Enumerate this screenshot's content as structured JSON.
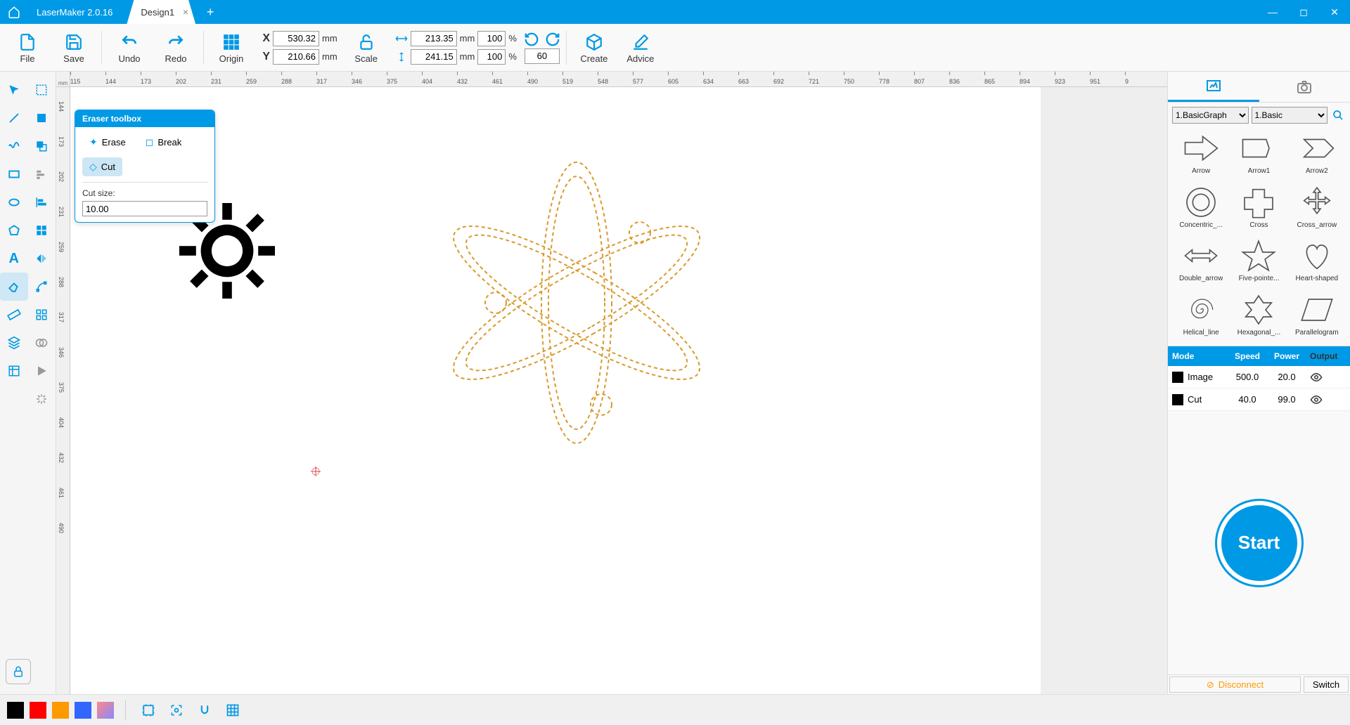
{
  "app": {
    "title": "LaserMaker 2.0.16",
    "tab_name": "Design1"
  },
  "toolbar": {
    "file": "File",
    "save": "Save",
    "undo": "Undo",
    "redo": "Redo",
    "origin": "Origin",
    "scale": "Scale",
    "create": "Create",
    "advice": "Advice",
    "x_label": "X",
    "y_label": "Y",
    "x_value": "530.32",
    "y_value": "210.66",
    "w_value": "213.35",
    "h_value": "241.15",
    "w_pct": "100",
    "h_pct": "100",
    "mm": "mm",
    "pct": "%",
    "rotate_value": "60"
  },
  "ruler": {
    "unit": "mm",
    "h_ticks": [
      "115",
      "144",
      "173",
      "202",
      "231",
      "259",
      "288",
      "317",
      "346",
      "375",
      "404",
      "432",
      "461",
      "490",
      "519",
      "548",
      "577",
      "605",
      "634",
      "663",
      "692",
      "721",
      "750",
      "778",
      "807",
      "836",
      "865",
      "894",
      "923",
      "951",
      "9"
    ],
    "v_ticks": [
      "144",
      "173",
      "202",
      "231",
      "259",
      "288",
      "317",
      "346",
      "375",
      "404",
      "432",
      "461",
      "490"
    ]
  },
  "eraser_toolbox": {
    "title": "Eraser toolbox",
    "erase": "Erase",
    "break": "Break",
    "cut": "Cut",
    "cut_size_label": "Cut size:",
    "cut_size_value": "10.00"
  },
  "shapes": {
    "category_select": "1.BasicGraph",
    "subcategory_select": "1.Basic",
    "items": [
      "Arrow",
      "Arrow1",
      "Arrow2",
      "Concentric_...",
      "Cross",
      "Cross_arrow",
      "Double_arrow",
      "Five-pointe...",
      "Heart-shaped",
      "Helical_line",
      "Hexagonal_...",
      "Parallelogram"
    ]
  },
  "layers": {
    "headers": {
      "mode": "Mode",
      "speed": "Speed",
      "power": "Power",
      "output": "Output"
    },
    "rows": [
      {
        "color": "#000000",
        "mode": "Image",
        "speed": "500.0",
        "power": "20.0"
      },
      {
        "color": "#000000",
        "mode": "Cut",
        "speed": "40.0",
        "power": "99.0"
      }
    ]
  },
  "start_button": "Start",
  "connection": {
    "status": "Disconnect",
    "switch": "Switch"
  },
  "colors": [
    "#000000",
    "#ff0000",
    "#ff9900",
    "#3366ff"
  ]
}
